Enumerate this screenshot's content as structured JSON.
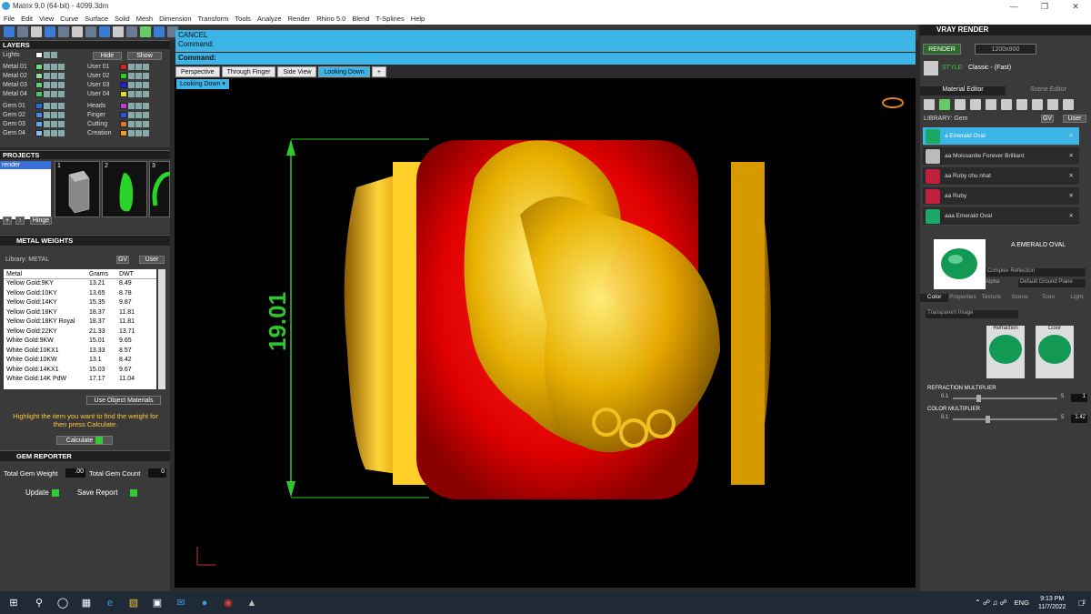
{
  "app": {
    "title": "Matrix 9.0 (64-bit) - 4099.3dm"
  },
  "menu": [
    "File",
    "Edit",
    "View",
    "Curve",
    "Surface",
    "Solid",
    "Mesh",
    "Dimension",
    "Transform",
    "Tools",
    "Analyze",
    "Render",
    "Rhino 5.0",
    "Blend",
    "T-Splines",
    "Help"
  ],
  "layers": {
    "title": "LAYERS",
    "lights": "Lights",
    "hide": "Hide",
    "show": "Show",
    "left": [
      {
        "label": "Metal 01",
        "color": "#6fdc6f"
      },
      {
        "label": "Metal 02",
        "color": "#8fe08f"
      },
      {
        "label": "Metal 03",
        "color": "#5fd36f"
      },
      {
        "label": "Metal 04",
        "color": "#4fc75f"
      },
      {
        "label": "Gem 01",
        "color": "#2a6fd6"
      },
      {
        "label": "Gem 02",
        "color": "#4a88e6"
      },
      {
        "label": "Gem 03",
        "color": "#6aa3ef"
      },
      {
        "label": "Gem 04",
        "color": "#8ab8f5"
      }
    ],
    "right": [
      {
        "label": "User 01",
        "color": "#e02020"
      },
      {
        "label": "User 02",
        "color": "#1fd61f"
      },
      {
        "label": "User 03",
        "color": "#2020e0"
      },
      {
        "label": "User 04",
        "color": "#e0e020"
      },
      {
        "label": "Heads",
        "color": "#c040d0"
      },
      {
        "label": "Finger",
        "color": "#3050e0"
      },
      {
        "label": "Cutting",
        "color": "#e07a20"
      },
      {
        "label": "Creation",
        "color": "#f0a020"
      }
    ]
  },
  "projects": {
    "title": "PROJECTS",
    "item": "render",
    "slots": [
      "1",
      "2",
      "3"
    ],
    "hinge": "Hinge"
  },
  "metal_weights": {
    "title": "METAL WEIGHTS",
    "library_label": "Library: METAL",
    "gv": "GV",
    "user": "User",
    "columns": [
      "Metal",
      "Grams",
      "DWT"
    ],
    "rows": [
      [
        "Yellow Gold:9KY",
        "13.21",
        "8.49"
      ],
      [
        "Yellow Gold:10KY",
        "13.65",
        "8.78"
      ],
      [
        "Yellow Gold:14KY",
        "15.35",
        "9.87"
      ],
      [
        "Yellow Gold:18KY",
        "18.37",
        "11.81"
      ],
      [
        "Yellow Gold:18KY Royal",
        "18.37",
        "11.81"
      ],
      [
        "Yellow Gold:22KY",
        "21.33",
        "13.71"
      ],
      [
        "White Gold:9KW",
        "15.01",
        "9.65"
      ],
      [
        "White Gold:10KX1",
        "13.33",
        "8.57"
      ],
      [
        "White Gold:10KW",
        "13.1",
        "8.42"
      ],
      [
        "White Gold:14KX1",
        "15.03",
        "9.67"
      ],
      [
        "White Gold:14K PdW",
        "17.17",
        "11.04"
      ]
    ],
    "use_object": "Use Object Materials",
    "hint": "Highlight the item you want to find the weight for then press Calculate.",
    "calculate": "Calculate"
  },
  "gem_reporter": {
    "title": "GEM REPORTER",
    "total_weight_label": "Total Gem Weight",
    "total_weight": ".00",
    "total_count_label": "Total Gem Count",
    "total_count": "0",
    "update": "Update",
    "save": "Save Report"
  },
  "command": {
    "line1": "CANCEL",
    "line2": "Command:",
    "prompt": "Command:"
  },
  "tabs": [
    "Perspective",
    "Through Finger",
    "Side View",
    "Looking Down"
  ],
  "view_label": "Looking Down",
  "dimension": "19.01",
  "vray": {
    "title": "VRAY RENDER",
    "render": "RENDER",
    "resolution": "1200x900",
    "style_label": "STYLE:",
    "style": "Classic - (Fast)",
    "material_editor": "Material Editor",
    "scene_editor": "Scene Editor",
    "library": "LIBRARY: Gem",
    "gv": "GV",
    "user": "User",
    "items": [
      {
        "label": "a Emerald Oval",
        "color": "#1aa866"
      },
      {
        "label": "aa Moissanite Forever Brilliant",
        "color": "#bbbbbb"
      },
      {
        "label": "aa Ruby chu nhat",
        "color": "#c02040"
      },
      {
        "label": "aa Ruby",
        "color": "#c02040"
      },
      {
        "label": "aaa Emerald Oval",
        "color": "#1aa866"
      }
    ],
    "preview_name": "A EMERALD OVAL",
    "refl": "Complex Reflection",
    "alpha": "Alpha",
    "ground": "Default Ground Plane",
    "subtabs": [
      "Color",
      "Properties",
      "Texture",
      "Scene",
      "Toon",
      "Light"
    ],
    "transparent": "Transparent Image",
    "refraction": "Refraction",
    "color": "Color",
    "refr_mult": "REFRACTION MULTIPLIER",
    "refr_min": "0.1",
    "refr_max": "5",
    "refr_val": "1",
    "color_mult": "COLOR MULTIPLIER",
    "col_min": "0.1",
    "col_max": "5",
    "col_val": "1.42"
  },
  "taskbar": {
    "lang": "ENG",
    "time": "9:13 PM",
    "date": "11/7/2022",
    "notif": "2"
  }
}
